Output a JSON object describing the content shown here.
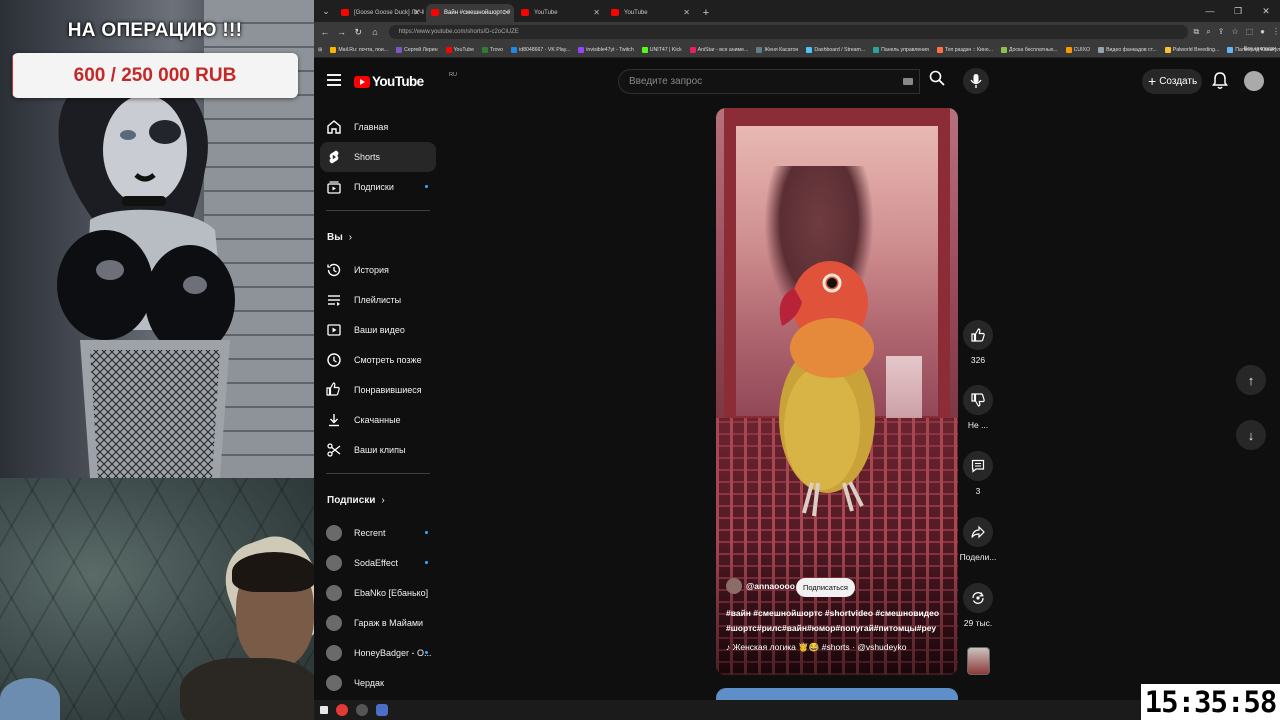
{
  "overlay": {
    "goal_title": "НА ОПЕРАЦИЮ !!!",
    "goal_amount": "600 / 250 000 RUB",
    "goal_progress": 0.0024
  },
  "browser": {
    "tabs": [
      {
        "title": "[Goose Goose Duck] ЛУЧШЕ З",
        "active": false
      },
      {
        "title": "Вайн #смешнойшортс #",
        "active": true
      },
      {
        "title": "YouTube",
        "active": false
      },
      {
        "title": "YouTube",
        "active": false
      }
    ],
    "url": "https://www.youtube.com/shorts/D-c2oCiUZE",
    "bookmarks": [
      "Mail.Ru: почта, пои...",
      "Сергей Лерин",
      "YouTube",
      "Trovo",
      "id8048667 - VK Play...",
      "invisible47yt - Twitch",
      "UNIT47 | Kick",
      "AniStar - все аниме...",
      "Женя Касатон",
      "Dashboard / Stream...",
      "Панель управления",
      "Топ раздач :: Кино...",
      "Доска бесплатных...",
      "CUIXO",
      "Видео фанкадов ст...",
      "Palworld Breeding...",
      "Палворлд Калькуля..."
    ],
    "bookmarks_all": "Все закладки"
  },
  "youtube": {
    "logo": "YouTube",
    "logo_region": "RU",
    "search_placeholder": "Введите запрос",
    "create_label": "Создать",
    "sidebar": {
      "main": [
        {
          "label": "Главная",
          "icon": "home-icon"
        },
        {
          "label": "Shorts",
          "icon": "shorts-icon",
          "active": true
        },
        {
          "label": "Подписки",
          "icon": "subscriptions-icon",
          "dot": true
        }
      ],
      "you_title": "Вы",
      "you": [
        {
          "label": "История",
          "icon": "history-icon"
        },
        {
          "label": "Плейлисты",
          "icon": "playlists-icon"
        },
        {
          "label": "Ваши видео",
          "icon": "your-videos-icon"
        },
        {
          "label": "Смотреть позже",
          "icon": "watch-later-icon"
        },
        {
          "label": "Понравившиеся",
          "icon": "liked-icon"
        },
        {
          "label": "Скачанные",
          "icon": "downloads-icon"
        },
        {
          "label": "Ваши клипы",
          "icon": "clips-icon"
        }
      ],
      "subs_title": "Подписки",
      "subs": [
        {
          "label": "Recrent",
          "dot": true
        },
        {
          "label": "SodaEffect",
          "dot": true
        },
        {
          "label": "EbaNko [Ебанько]"
        },
        {
          "label": "Гараж в Майами"
        },
        {
          "label": "HoneyBadger - O...",
          "dot": true
        },
        {
          "label": "Чердак"
        }
      ]
    },
    "short": {
      "channel": "@annaoooo",
      "subscribe_label": "Подписаться",
      "tags": "#вайн #смешнойшортс #shortvideo #смешновидео #шортс#рилс#вайн#юмор#попугай#питомцы#рey",
      "music": "♪ Женская логика 🤴😂 #shorts · @vshudeyko"
    },
    "actions": {
      "likes": "326",
      "dislike": "Не ...",
      "comments": "3",
      "share": "Подели...",
      "remix": "29 тыс."
    }
  },
  "clock": "15:35:58",
  "colors": {
    "brand_red": "#ff0000",
    "goal_red": "#c62828",
    "link_blue": "#3ea6ff"
  }
}
